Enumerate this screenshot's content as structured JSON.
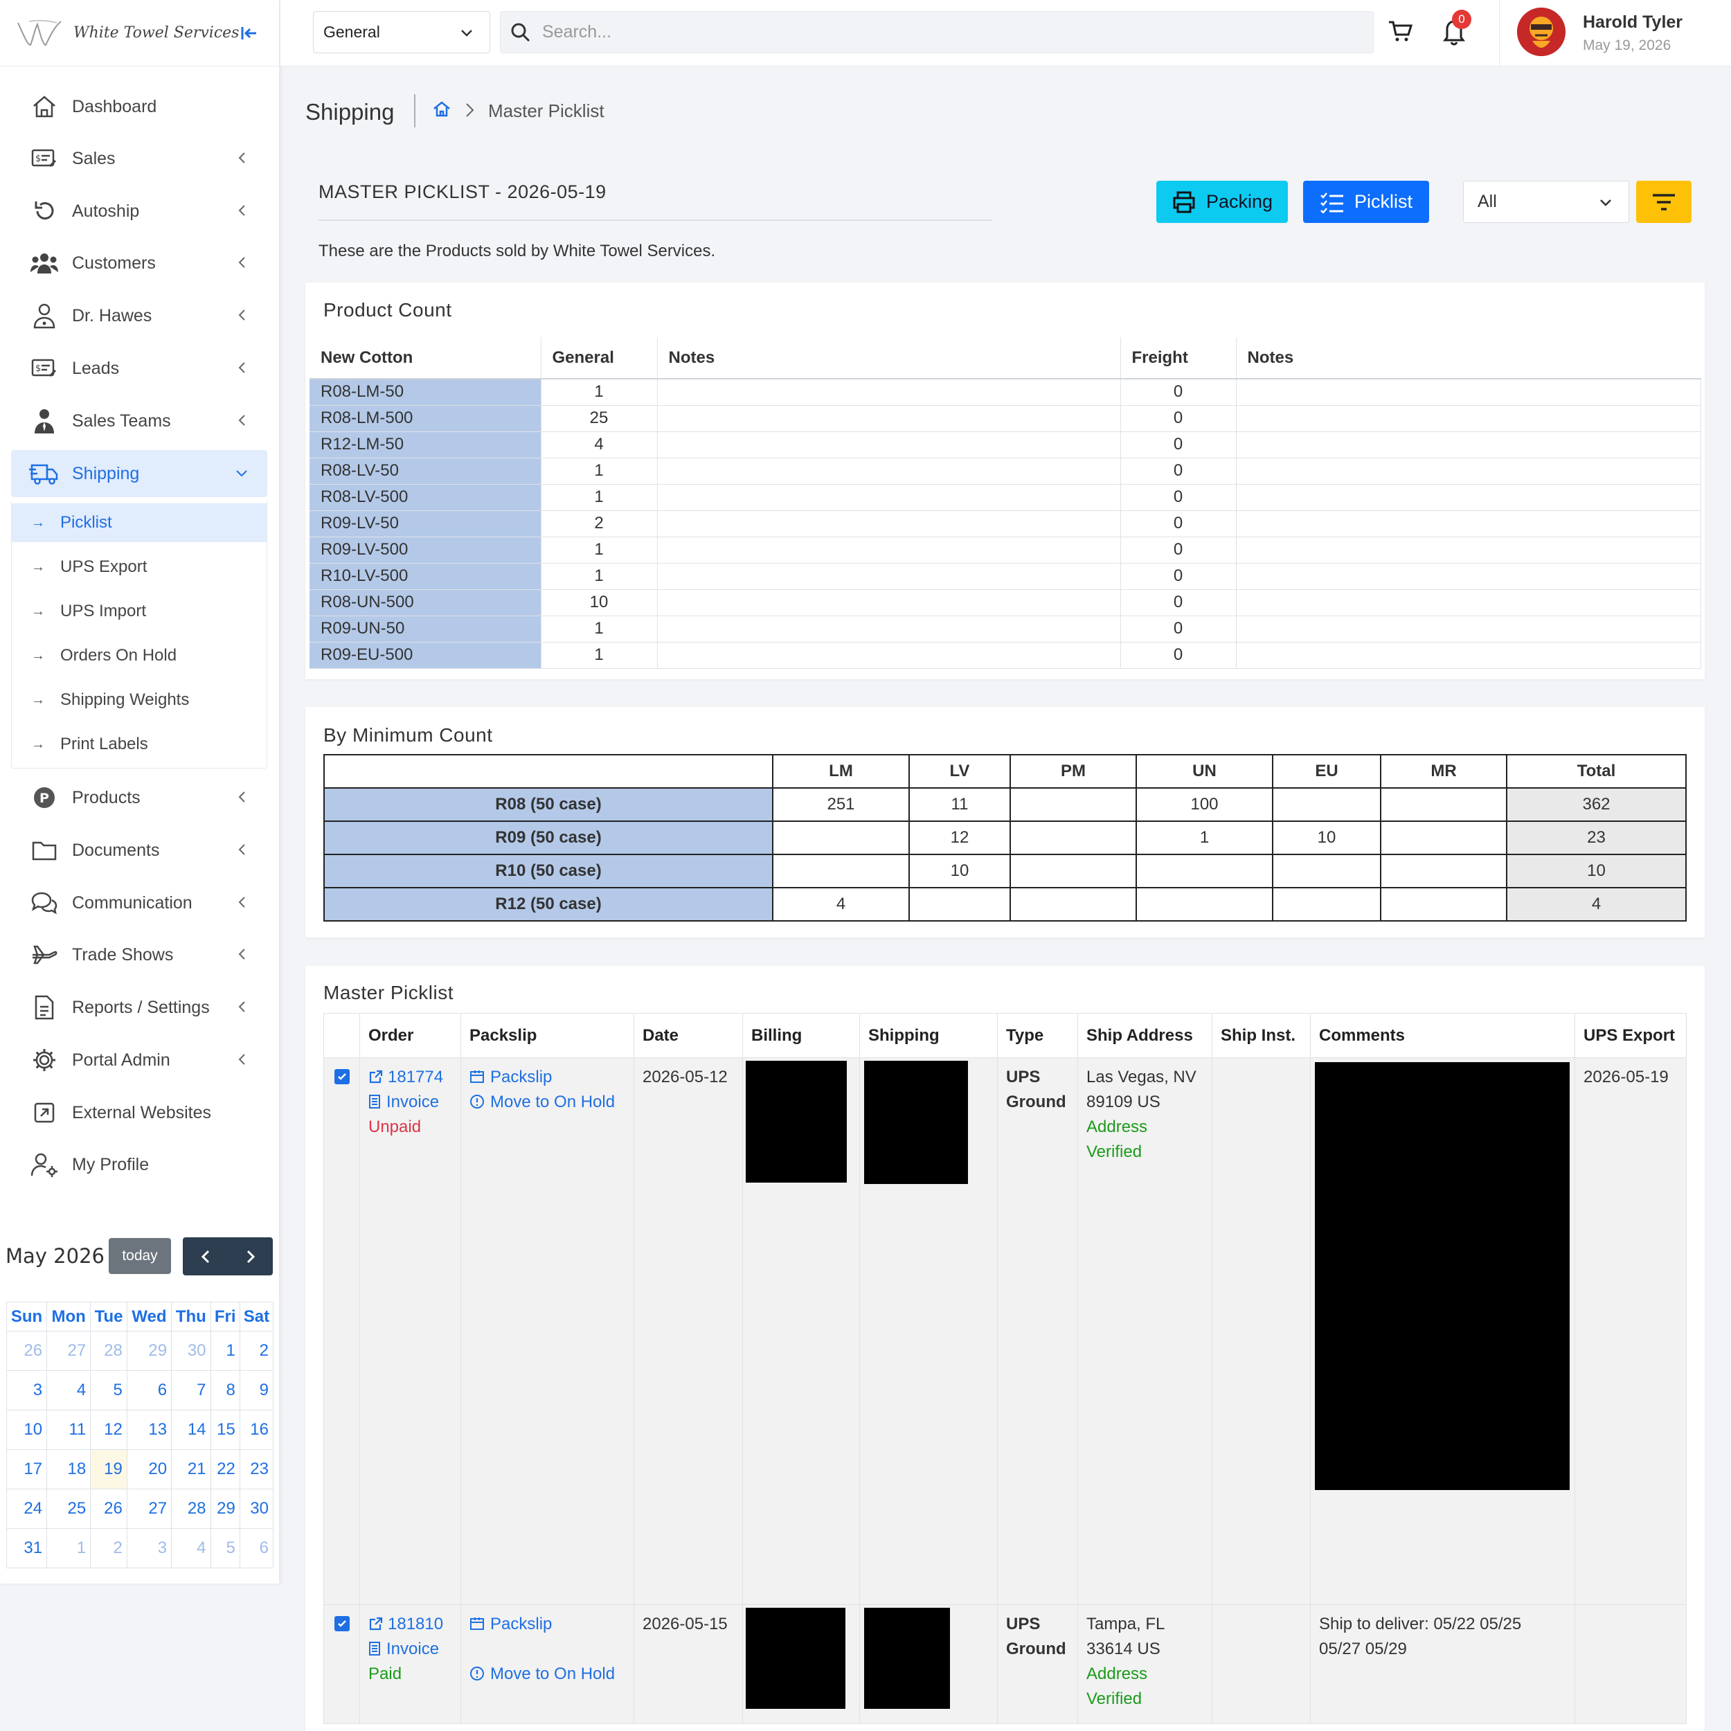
{
  "app": {
    "logo_text": "White Towel Services"
  },
  "sidebar": {
    "items": [
      {
        "label": "Dashboard",
        "icon": "home-icon"
      },
      {
        "label": "Sales",
        "icon": "sales-icon"
      },
      {
        "label": "Autoship",
        "icon": "refresh-icon"
      },
      {
        "label": "Customers",
        "icon": "users-icon"
      },
      {
        "label": "Dr. Hawes",
        "icon": "doctor-icon"
      },
      {
        "label": "Leads",
        "icon": "leads-icon"
      },
      {
        "label": "Sales Teams",
        "icon": "team-icon"
      },
      {
        "label": "Shipping",
        "icon": "truck-icon"
      },
      {
        "label": "Products",
        "icon": "products-icon"
      },
      {
        "label": "Documents",
        "icon": "folder-icon"
      },
      {
        "label": "Communication",
        "icon": "chat-icon"
      },
      {
        "label": "Trade Shows",
        "icon": "plane-icon"
      },
      {
        "label": "Reports / Settings",
        "icon": "report-icon"
      },
      {
        "label": "Portal Admin",
        "icon": "gear-icon"
      },
      {
        "label": "External Websites",
        "icon": "external-link-icon"
      },
      {
        "label": "My Profile",
        "icon": "user-settings-icon"
      }
    ],
    "shipping_sub": [
      "Picklist",
      "UPS Export",
      "UPS Import",
      "Orders On Hold",
      "Shipping Weights",
      "Print Labels"
    ]
  },
  "calendar": {
    "title": "May 2026",
    "today_label": "today",
    "weekdays": [
      "Sun",
      "Mon",
      "Tue",
      "Wed",
      "Thu",
      "Fri",
      "Sat"
    ],
    "weeks": [
      [
        "26",
        "27",
        "28",
        "29",
        "30",
        "1",
        "2"
      ],
      [
        "3",
        "4",
        "5",
        "6",
        "7",
        "8",
        "9"
      ],
      [
        "10",
        "11",
        "12",
        "13",
        "14",
        "15",
        "16"
      ],
      [
        "17",
        "18",
        "19",
        "20",
        "21",
        "22",
        "23"
      ],
      [
        "24",
        "25",
        "26",
        "27",
        "28",
        "29",
        "30"
      ],
      [
        "31",
        "1",
        "2",
        "3",
        "4",
        "5",
        "6"
      ]
    ]
  },
  "topbar": {
    "scope": "General",
    "search_placeholder": "Search...",
    "notifications": "0",
    "user_name": "Harold Tyler",
    "user_date": "May 19, 2026"
  },
  "page": {
    "title": "Shipping",
    "breadcrumb_current": "Master Picklist",
    "heading": "MASTER PICKLIST - 2026-05-19",
    "packing_label": "Packing",
    "picklist_label": "Picklist",
    "filter_value": "All",
    "description": "These are the Products sold by White Towel Services."
  },
  "product_count": {
    "title": "Product Count",
    "headers": [
      "New Cotton",
      "General",
      "Notes",
      "Freight",
      "Notes"
    ],
    "rows": [
      [
        "R08-LM-50",
        "1",
        "",
        "0",
        ""
      ],
      [
        "R08-LM-500",
        "25",
        "",
        "0",
        ""
      ],
      [
        "R12-LM-50",
        "4",
        "",
        "0",
        ""
      ],
      [
        "R08-LV-50",
        "1",
        "",
        "0",
        ""
      ],
      [
        "R08-LV-500",
        "1",
        "",
        "0",
        ""
      ],
      [
        "R09-LV-50",
        "2",
        "",
        "0",
        ""
      ],
      [
        "R09-LV-500",
        "1",
        "",
        "0",
        ""
      ],
      [
        "R10-LV-500",
        "1",
        "",
        "0",
        ""
      ],
      [
        "R08-UN-500",
        "10",
        "",
        "0",
        ""
      ],
      [
        "R09-UN-50",
        "1",
        "",
        "0",
        ""
      ],
      [
        "R09-EU-500",
        "1",
        "",
        "0",
        ""
      ]
    ]
  },
  "min_count": {
    "title": "By Minimum Count",
    "headers": [
      "",
      "LM",
      "LV",
      "PM",
      "UN",
      "EU",
      "MR",
      "Total"
    ],
    "rows": [
      [
        "R08 (50 case)",
        "251",
        "11",
        "",
        "100",
        "",
        "",
        "362"
      ],
      [
        "R09 (50 case)",
        "",
        "12",
        "",
        "1",
        "10",
        "",
        "23"
      ],
      [
        "R10 (50 case)",
        "",
        "10",
        "",
        "",
        "",
        "",
        "10"
      ],
      [
        "R12 (50 case)",
        "4",
        "",
        "",
        "",
        "",
        "",
        "4"
      ]
    ]
  },
  "master_picklist": {
    "title": "Master Picklist",
    "headers": [
      "",
      "Order",
      "Packslip",
      "Date",
      "Billing",
      "Shipping",
      "Type",
      "Ship Address",
      "Ship Inst.",
      "Comments",
      "UPS Export"
    ],
    "orders": [
      {
        "order": "181774",
        "invoice": "Invoice",
        "status": "Unpaid",
        "packslip": "Packslip",
        "hold": "Move to On Hold",
        "date": "2026-05-12",
        "type_line1": "UPS",
        "type_line2": "Ground",
        "addr1": "Las Vegas, NV",
        "addr2": "89109 US",
        "verified1": "Address",
        "verified2": "Verified",
        "ship_inst": "",
        "comments": "",
        "ups_export": "2026-05-19"
      },
      {
        "order": "181810",
        "invoice": "Invoice",
        "status": "Paid",
        "packslip": "Packslip",
        "hold": "Move to On Hold",
        "date": "2026-05-15",
        "type_line1": "UPS",
        "type_line2": "Ground",
        "addr1": "Tampa, FL",
        "addr2": "33614 US",
        "verified1": "Address",
        "verified2": "Verified",
        "ship_inst": "",
        "comments": "Ship to deliver: 05/22 05/25 05/27 05/29",
        "ups_export": ""
      }
    ]
  },
  "colors": {
    "accent": "#1e6fe3",
    "packing": "#0dcaf0",
    "picklist": "#0d6efd",
    "filter": "#ffc107",
    "sku_bg": "#b4c9e8"
  }
}
